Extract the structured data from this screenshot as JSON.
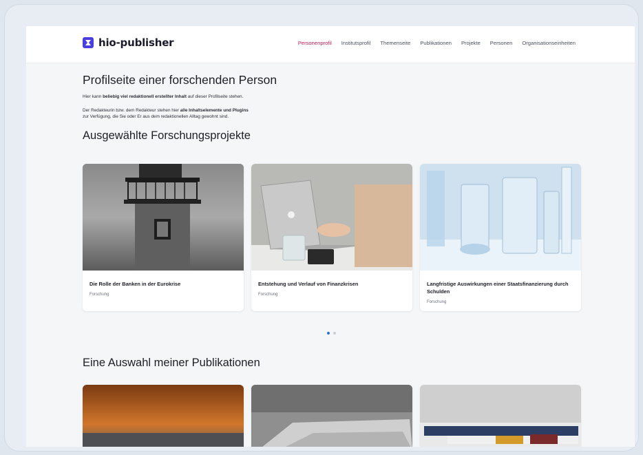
{
  "brand": {
    "name": "hio-publisher",
    "accent": "#4a3fe0"
  },
  "nav": {
    "items": [
      {
        "label": "Personenprofil",
        "active": true
      },
      {
        "label": "Institutsprofil"
      },
      {
        "label": "Themenseite"
      },
      {
        "label": "Publikationen"
      },
      {
        "label": "Projekte"
      },
      {
        "label": "Personen"
      },
      {
        "label": "Organisationseinheiten"
      }
    ],
    "active_color": "#c0195a"
  },
  "intro": {
    "title": "Profilseite einer forschenden Person",
    "line1_pre": "Hier kann ",
    "line1_bold": "beliebig viel redaktionell erstellter Inhalt",
    "line1_post": " auf dieser Profilseite stehen.",
    "line2_pre": "Der Redakteurin bzw. dem Redakteur stehen hier ",
    "line2_bold": "alle Inhaltselemente und Plugins",
    "line3": "zur Verfügung, die Sie oder Er aus dem redaktionellen Alltag gewohnt sind."
  },
  "projects": {
    "heading": "Ausgewählte Forschungsprojekte",
    "cards": [
      {
        "title": "Die Rolle der Banken in der Eurokrise",
        "category": "Forschung",
        "image": "lighthouse-photo"
      },
      {
        "title": "Entstehung und Verlauf von Finanzkrisen",
        "category": "Forschung",
        "image": "laptop-photo"
      },
      {
        "title": "Langfristige Auswirkungen einer Staatsfinanzierung durch Schulden",
        "category": "Forschung",
        "image": "lab-glassware-photo"
      }
    ],
    "carousel": {
      "pages": 2,
      "current": 1,
      "active_color": "#2f6fd6"
    }
  },
  "publications": {
    "heading": "Eine Auswahl meiner Publikationen",
    "cards": [
      {
        "image": "books-photo"
      },
      {
        "image": "newspapers-photo"
      },
      {
        "image": "rolled-newspapers-photo"
      }
    ]
  }
}
